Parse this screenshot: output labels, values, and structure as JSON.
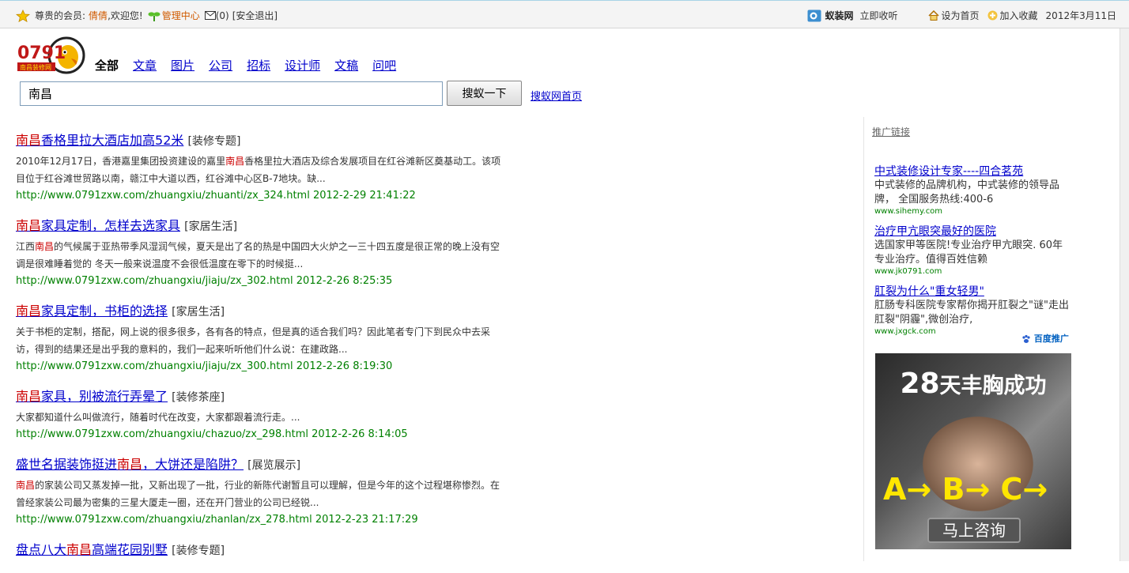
{
  "topbar": {
    "greeting": "尊贵的会员:",
    "username": "倩倩",
    "welcome": ",欢迎您!",
    "admin": "管理中心",
    "mail": "(0)",
    "logout": "[安全退出]",
    "site_name": "蚁装网",
    "bookmark_now": "立即收听",
    "set_home": "设为首页",
    "add_fav": "加入收藏",
    "date": "2012年3月11日"
  },
  "logo": {
    "number": "0791",
    "name": "南昌装修网"
  },
  "nav": {
    "items": [
      {
        "label": "全部",
        "current": true
      },
      {
        "label": "文章"
      },
      {
        "label": "图片"
      },
      {
        "label": "公司"
      },
      {
        "label": "招标"
      },
      {
        "label": "设计师"
      },
      {
        "label": "文稿"
      },
      {
        "label": "问吧"
      }
    ]
  },
  "search": {
    "value": "南昌",
    "button": "搜蚁一下",
    "home_link": "搜蚁网首页"
  },
  "results": [
    {
      "title_hl": "南昌",
      "title_rest": "香格里拉大酒店加高52米",
      "category": "[装修专题]",
      "snippet_pre": "2010年12月17日，香港嘉里集团投资建设的嘉里",
      "snippet_hl": "南昌",
      "snippet_post": "香格里拉大酒店及综合发展项目在红谷滩新区奠基动工。该项目位于红谷滩世贸路以南，赣江中大道以西，红谷滩中心区B-7地块。缺...",
      "url": "http://www.0791zxw.com/zhuangxiu/zhuanti/zx_324.html 2012-2-29 21:41:22"
    },
    {
      "title_hl": "南昌",
      "title_rest": "家具定制，怎样去选家具",
      "category": "[家居生活]",
      "snippet_pre": "江西",
      "snippet_hl": "南昌",
      "snippet_post": "的气候属于亚热带季风湿润气候，夏天是出了名的热是中国四大火炉之一三十四五度是很正常的晚上没有空调是很难睡着觉的 冬天一般来说温度不会很低温度在零下的时候挺...",
      "url": "http://www.0791zxw.com/zhuangxiu/jiaju/zx_302.html 2012-2-26 8:25:35"
    },
    {
      "title_hl": "南昌",
      "title_rest": "家具定制，书柜的选择",
      "category": "[家居生活]",
      "snippet_pre": "关于书柜的定制，搭配，网上说的很多很多，各有各的特点，但是真的适合我们吗？因此笔者专门下到民众中去采访，得到的结果还是出乎我的意料的，我们一起来听听他们什么说：在建政路...",
      "snippet_hl": "",
      "snippet_post": "",
      "url": "http://www.0791zxw.com/zhuangxiu/jiaju/zx_300.html 2012-2-26 8:19:30"
    },
    {
      "title_hl": "南昌",
      "title_rest": "家具，别被流行弄晕了",
      "category": "[装修茶座]",
      "snippet_pre": "大家都知道什么叫做流行，随着时代在改变，大家都跟着流行走。...",
      "snippet_hl": "",
      "snippet_post": "",
      "url": "http://www.0791zxw.com/zhuangxiu/chazuo/zx_298.html 2012-2-26 8:14:05"
    },
    {
      "title_pre": "盛世名据装饰挺进",
      "title_hl": "南昌",
      "title_rest": "，大饼还是陷阱？",
      "category": "[展览展示]",
      "snippet_pre": "",
      "snippet_hl": "南昌",
      "snippet_post": "的家装公司又蒸发掉一批，又新出现了一批，行业的新陈代谢暂且可以理解，但是今年的这个过程堪称惨烈。在曾经家装公司最为密集的三星大厦走一圈，还在开门营业的公司已经锐...",
      "url": "http://www.0791zxw.com/zhuangxiu/zhanlan/zx_278.html 2012-2-23 21:17:29"
    },
    {
      "title_pre": "盘点八大",
      "title_hl": "南昌",
      "title_rest": "高端花园别墅",
      "category": "[装修专题]",
      "snippet_pre": "",
      "snippet_hl": "",
      "snippet_post": "",
      "url": ""
    }
  ],
  "sidebar": {
    "promo_heading": "推广链接",
    "ads": [
      {
        "title": "中式装修设计专家----四合茗苑",
        "desc": "中式装修的品牌机构，中式装修的领导品牌， 全国服务热线:400-6",
        "url": "www.sihemy.com"
      },
      {
        "title": "治疗甲亢眼突最好的医院",
        "desc": "选国家甲等医院!专业治疗甲亢眼突. 60年专业治疗。值得百姓信赖",
        "url": "www.jk0791.com"
      },
      {
        "title": "肛裂为什么\"重女轻男\"",
        "desc": "肛肠专科医院专家帮你揭开肛裂之\"谜\"走出肛裂\"阴霾\",微创治疗,",
        "url": "www.jxgck.com"
      }
    ],
    "baidu_label": "百度推广",
    "banner": {
      "num": "28",
      "headline": "天丰胸成功",
      "abc": "A→ B→ C→",
      "cta": "马上咨询"
    }
  },
  "colors": {
    "link": "#0000cc",
    "highlight": "#cc0000",
    "url": "#008000"
  }
}
